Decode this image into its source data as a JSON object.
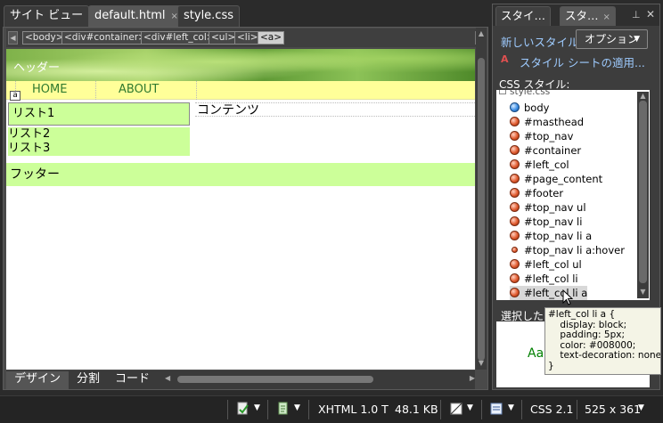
{
  "doc_tabs": [
    {
      "label": "サイト ビュー"
    },
    {
      "label": "default.html",
      "close": "×"
    },
    {
      "label": "style.css"
    }
  ],
  "breadcrumbs": [
    "<body>",
    "<div#container>",
    "<div#left_col>",
    "<ul>",
    "<li>",
    "<a>"
  ],
  "design": {
    "masthead": "ヘッダー",
    "nav": [
      "HOME",
      "ABOUT"
    ],
    "a_tag": "a",
    "left_items": [
      "リスト1",
      "リスト2",
      "リスト3"
    ],
    "content": "コンテンツ",
    "footer": "フッター"
  },
  "view_tabs": [
    "デザイン",
    "分割",
    "コード"
  ],
  "panel": {
    "tabs": [
      {
        "label": "スタイ…"
      },
      {
        "label": "スタ…",
        "close": "×"
      }
    ],
    "new_style": "新しいスタイル...",
    "options": "オプション",
    "attach": "スタイル シートの適用...",
    "css_label": "CSS スタイル:",
    "stylesheet": "style.css",
    "rules": [
      {
        "name": "body",
        "kind": "blue"
      },
      {
        "name": "#masthead",
        "kind": "red"
      },
      {
        "name": "#top_nav",
        "kind": "red"
      },
      {
        "name": "#container",
        "kind": "red"
      },
      {
        "name": "#left_col",
        "kind": "red"
      },
      {
        "name": "#page_content",
        "kind": "red"
      },
      {
        "name": "#footer",
        "kind": "red"
      },
      {
        "name": "#top_nav ul",
        "kind": "red"
      },
      {
        "name": "#top_nav li",
        "kind": "red"
      },
      {
        "name": "#top_nav li a",
        "kind": "red"
      },
      {
        "name": "#top_nav li a:hover",
        "kind": "small"
      },
      {
        "name": "#left_col ul",
        "kind": "red"
      },
      {
        "name": "#left_col li",
        "kind": "red"
      },
      {
        "name": "#left_col li a",
        "kind": "red"
      }
    ],
    "selected_label": "選択したスタイル",
    "preview": "AaBbYyZz",
    "tooltip": "#left_col li a {\n    display: block;\n    padding: 5px;\n    color: #008000;\n    text-decoration: none;\n}"
  },
  "status": {
    "doctype": "XHTML 1.0 T",
    "size": "48.1 KB",
    "css": "CSS 2.1",
    "dims": "525 x 361"
  },
  "colors": {
    "nav_bg": "#ffff99",
    "left_bg": "#ccff99",
    "link": "#2f7a2f",
    "panel_link": "#9ecbff",
    "preview_text": "#008000"
  }
}
